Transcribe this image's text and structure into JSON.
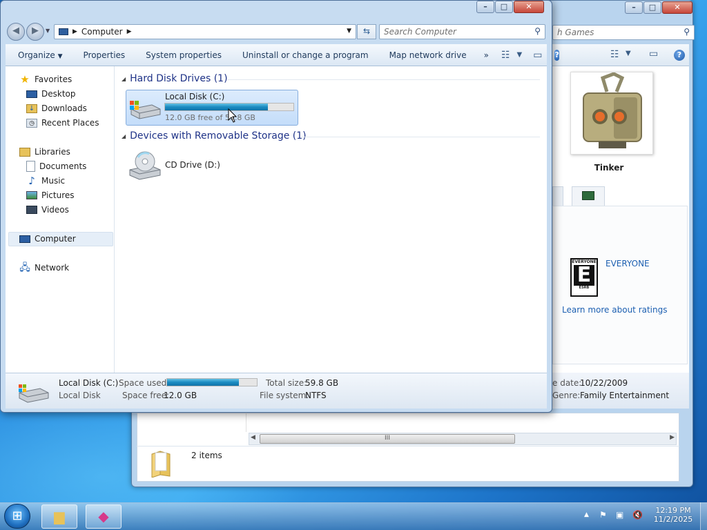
{
  "explorer": {
    "breadcrumb": "Computer",
    "search_placeholder": "Search Computer",
    "toolbar": {
      "organize": "Organize",
      "properties": "Properties",
      "system_properties": "System properties",
      "uninstall": "Uninstall or change a program",
      "map_drive": "Map network drive",
      "more": "»"
    },
    "nav": {
      "favorites": "Favorites",
      "desktop": "Desktop",
      "downloads": "Downloads",
      "recent_places": "Recent Places",
      "libraries": "Libraries",
      "documents": "Documents",
      "music": "Music",
      "pictures": "Pictures",
      "videos": "Videos",
      "computer": "Computer",
      "network": "Network"
    },
    "groups": {
      "hard_disk_header": "Hard Disk Drives (1)",
      "removable_header": "Devices with Removable Storage (1)"
    },
    "drives": {
      "local_disk_name": "Local Disk (C:)",
      "local_disk_space": "12.0 GB free of 59.8 GB",
      "local_disk_used_fraction": 0.8,
      "cd_drive_name": "CD Drive (D:)"
    },
    "status": {
      "name": "Local Disk (C:)",
      "type": "Local Disk",
      "space_used_label": "Space used:",
      "space_used_fraction": 0.8,
      "space_free_label": "Space free:",
      "space_free_value": "12.0 GB",
      "total_size_label": "Total size:",
      "total_size_value": "59.8 GB",
      "file_system_label": "File system:",
      "file_system_value": "NTFS"
    }
  },
  "games_window": {
    "search_placeholder_fragment": "h Games",
    "game_title": "Tinker",
    "rating": "EVERYONE",
    "ratings_link": "Learn more about ratings",
    "release_date_label": "e date:",
    "release_date_value": "10/22/2009",
    "genre_label": "Genre:",
    "genre_value": "Family Entertainment",
    "items_count": "2 items",
    "scroll_grip": "III"
  },
  "taskbar": {
    "time": "12:19 PM",
    "date": "11/2/2025"
  },
  "colors": {
    "accent": "#1e3287",
    "selection": "#c4ddfa",
    "progress": "#1a8bc1"
  }
}
